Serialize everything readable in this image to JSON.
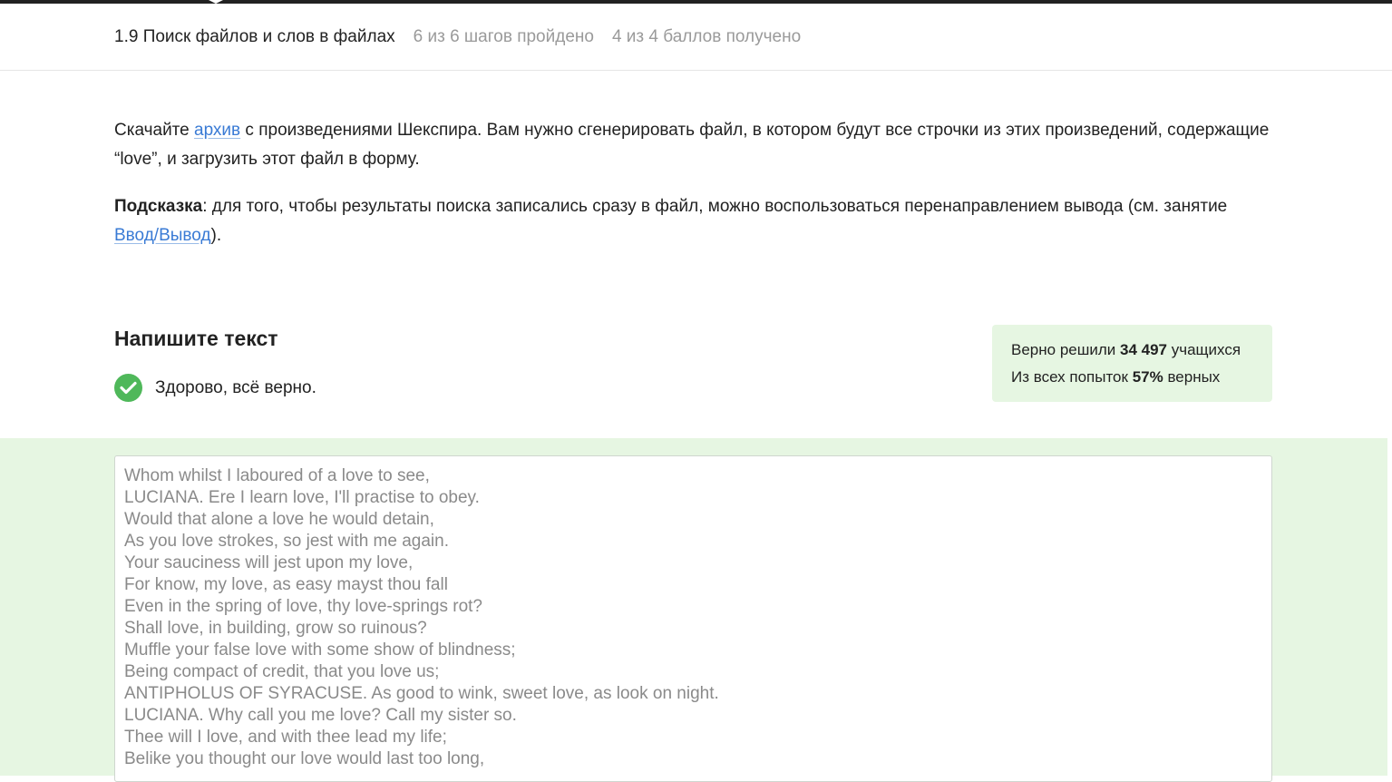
{
  "header": {
    "lesson_title": "1.9 Поиск файлов и слов в файлах",
    "steps_progress": "6 из 6 шагов пройдено",
    "points_progress": "4 из 4 баллов  получено"
  },
  "step": {
    "p1_before": "Скачайте ",
    "p1_link": "архив",
    "p1_after": " с произведениями Шекспира. Вам нужно сгенерировать файл, в котором будут все строчки из этих произведений, содержащие “love”, и загрузить этот файл в форму.",
    "hint_label": "Подсказка",
    "hint_text": ": для того, чтобы результаты поиска записались сразу в файл, можно воспользоваться перенаправлением вывода (см. занятие ",
    "hint_link": "Ввод/Вывод",
    "hint_end": ")."
  },
  "quiz": {
    "title": "Напишите текст",
    "result": "Здорово, всё верно."
  },
  "stats": {
    "line1_prefix": "Верно решили ",
    "line1_value": "34 497",
    "line1_suffix": " учащихся",
    "line2_prefix": "Из всех попыток ",
    "line2_value": "57%",
    "line2_suffix": " верных"
  },
  "answer": {
    "lines": [
      "Whom whilst I laboured of a love to see,",
      "LUCIANA. Ere I learn love, I'll practise to obey.",
      "Would that alone a love he would detain,",
      "As you love strokes, so jest with me again.",
      "Your sauciness will jest upon my love,",
      "For know, my love, as easy mayst thou fall",
      "Even in the spring of love, thy love-springs rot?",
      "Shall love, in building, grow so ruinous?",
      "Muffle your false love with some show of blindness;",
      "Being compact of credit, that you love us;",
      "ANTIPHOLUS OF SYRACUSE. As good to wink, sweet love, as look on night.",
      "LUCIANA. Why call you me love? Call my sister so.",
      "Thee will I love, and with thee lead my life;",
      "Belike you thought our love would last too long,"
    ]
  },
  "colors": {
    "link": "#3a7bd5",
    "success": "#4fb85a",
    "success_bg": "#e6f6e2"
  }
}
